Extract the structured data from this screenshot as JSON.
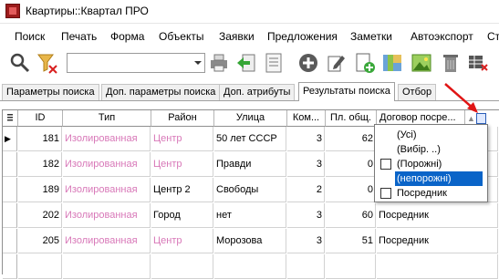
{
  "window": {
    "title": "Квартиры::Квартал ПРО"
  },
  "menu": [
    "Поиск",
    "Печать",
    "Форма",
    "Объекты",
    "Заявки",
    "Предложения",
    "Заметки",
    "Автоэкспорт",
    "Ст"
  ],
  "toolbar": {
    "combo_value": "",
    "icons": [
      "search-icon",
      "filter-clear-icon",
      "print-icon",
      "import-icon",
      "list-icon",
      "add-circle-icon",
      "edit-icon",
      "new-document-icon",
      "map-icon",
      "image-icon",
      "delete-icon",
      "grid-settings-icon"
    ]
  },
  "tabs": [
    "Параметры поиска",
    "Доп. параметры поиска",
    "Доп. атрибуты",
    "Результаты поиска",
    "Отбор"
  ],
  "active_tab": "Результаты поиска",
  "table": {
    "columns": [
      "ID",
      "Тип",
      "Район",
      "Улица",
      "Ком...",
      "Пл. общ.",
      "Договор посре..."
    ],
    "rows": [
      {
        "id": "181",
        "type": "Изолированная",
        "district": "Центр",
        "street": "50 лет СССР",
        "rooms": "3",
        "area": "62",
        "contract": ""
      },
      {
        "id": "182",
        "type": "Изолированная",
        "district": "Центр",
        "street": "Правди",
        "rooms": "3",
        "area": "0",
        "contract": ""
      },
      {
        "id": "189",
        "type": "Изолированная",
        "district": "Центр 2",
        "street": "Свободы",
        "rooms": "2",
        "area": "0",
        "contract": ""
      },
      {
        "id": "202",
        "type": "Изолированная",
        "district": "Город",
        "street": "нет",
        "rooms": "3",
        "area": "60",
        "contract": "Посредник"
      },
      {
        "id": "205",
        "type": "Изолированная",
        "district": "Центр",
        "street": "Морозова",
        "rooms": "3",
        "area": "51",
        "contract": "Посредник"
      }
    ]
  },
  "filter_popup": {
    "items": [
      "(Усі)",
      "(Вибір. ..)",
      "(Порожні)",
      "(непорожні)",
      "Посредник"
    ],
    "selected": "(непорожні)"
  },
  "colors": {
    "pink_text": "#d878b8",
    "selection": "#0a64c8",
    "arrow": "#e01515"
  }
}
